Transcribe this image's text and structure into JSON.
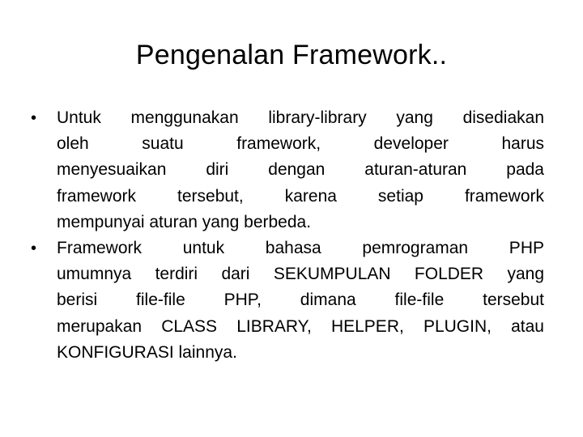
{
  "slide": {
    "title": "Pengenalan Framework..",
    "bullets": [
      {
        "icon": "bullet-dot",
        "lines": [
          "Untuk menggunakan library-library yang disediakan",
          "oleh suatu framework, developer harus",
          "menyesuaikan diri dengan aturan-aturan pada",
          "framework tersebut, karena setiap framework",
          "mempunyai aturan yang berbeda."
        ]
      },
      {
        "icon": "bullet-dot",
        "lines": [
          "Framework untuk bahasa pemrograman PHP",
          "umumnya terdiri dari SEKUMPULAN FOLDER yang",
          "berisi file-file PHP, dimana file-file tersebut",
          "merupakan CLASS LIBRARY, HELPER, PLUGIN, atau",
          "KONFIGURASI lainnya."
        ]
      }
    ],
    "bullet_glyph": "•"
  }
}
